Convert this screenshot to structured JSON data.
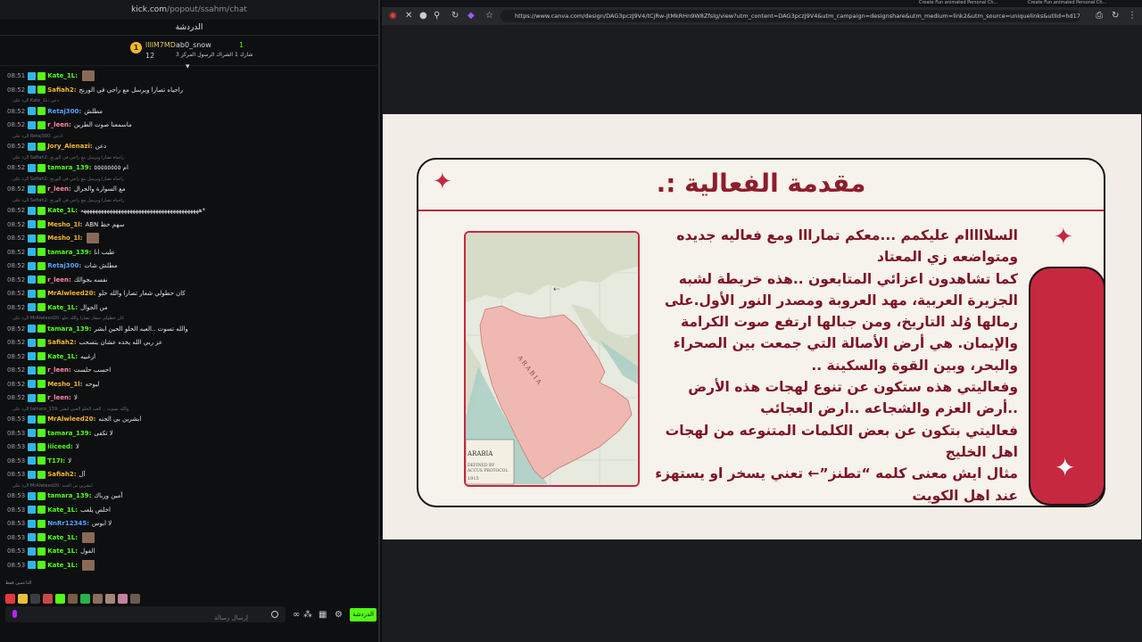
{
  "chat": {
    "url_domain": "kick.com",
    "url_path": "/popout/ssahm/chat",
    "title": "الدردشة",
    "pinned": {
      "gift_count_badge": "1",
      "user1": "llllM7MD",
      "user1_count": "12",
      "user2": "ab0_snow",
      "user2_text": "شارك 1 الشراك الرسول المركز 3",
      "user3_count": "1"
    },
    "messages": [
      {
        "type": "msg",
        "time": "08:51",
        "user": "Kate_1L:",
        "color": "#53fc18",
        "text": "",
        "pic": true
      },
      {
        "type": "msg",
        "time": "08:52",
        "user": "Safiah2:",
        "color": "#f2b632",
        "text": "راجياه تصارا ويرسل مع راجي في الورنج"
      },
      {
        "type": "reply",
        "text": "الرد على Kate_1L: دعن"
      },
      {
        "type": "msg",
        "time": "08:52",
        "user": "Retaj300:",
        "color": "#5aa2ff",
        "text": "مطلش"
      },
      {
        "type": "msg",
        "time": "08:52",
        "user": "r_leen:",
        "color": "#ff8aa8",
        "text": "ماسمعنا صوت الطرين"
      },
      {
        "type": "reply",
        "text": "الرد على Retaj300: ادعن"
      },
      {
        "type": "msg",
        "time": "08:52",
        "user": "Jory_Alenazi:",
        "color": "#f2b632",
        "text": "دعن"
      },
      {
        "type": "reply",
        "text": "الرد على Safiah2: راجياه تصارا ويرسل مع راجي في الورنج"
      },
      {
        "type": "msg",
        "time": "08:52",
        "user": "tamara_139:",
        "color": "#53fc18",
        "text": "ام ٥٥٥٥٥٥٥٥"
      },
      {
        "type": "reply",
        "text": "الرد على Safiah2: راجياه تصارا ويرسل مع راجي في الورنج"
      },
      {
        "type": "msg",
        "time": "08:52",
        "user": "r_leen:",
        "color": "#ff8aa8",
        "text": "مع السوارة والجرال"
      },
      {
        "type": "reply",
        "text": "الرد على Safiah2: راجياه تصارا ويرسل مع راجي في الورنج"
      },
      {
        "type": "msg",
        "time": "08:52",
        "user": "Kate_1L:",
        "color": "#53fc18",
        "text": "هههههههههههههههههههههههههههههههههههههههههه*"
      },
      {
        "type": "msg",
        "time": "08:52",
        "user": "Mesho_1l:",
        "color": "#f2b632",
        "text": "ABN سهم حظ"
      },
      {
        "type": "msg",
        "time": "08:52",
        "user": "Mesho_1l:",
        "color": "#f2b632",
        "text": "",
        "pic": true
      },
      {
        "type": "msg",
        "time": "08:52",
        "user": "tamara_139:",
        "color": "#53fc18",
        "text": "طيب انا"
      },
      {
        "type": "msg",
        "time": "08:52",
        "user": "Retaj300:",
        "color": "#5aa2ff",
        "text": "مطلش شات"
      },
      {
        "type": "msg",
        "time": "08:52",
        "user": "r_leen:",
        "color": "#ff8aa8",
        "text": "نفسه بجوالك"
      },
      {
        "type": "msg",
        "time": "08:52",
        "user": "MrAlwleed20:",
        "color": "#f2b632",
        "text": "كان حطولي شعار تصارا والله حلو"
      },
      {
        "type": "msg",
        "time": "08:52",
        "user": "Kate_1L:",
        "color": "#53fc18",
        "text": "من الجوال"
      },
      {
        "type": "reply",
        "text": "الرد على MrAlwleed20: كان حطولي شعار تصارا والله حلو"
      },
      {
        "type": "msg",
        "time": "08:52",
        "user": "tamara_139:",
        "color": "#53fc18",
        "text": "والله تسوت ..العبه الحلو الحين ابشر"
      },
      {
        "type": "msg",
        "time": "08:52",
        "user": "Safiah2:",
        "color": "#f2b632",
        "text": "عز ربي الله يخده عشان يتسحب"
      },
      {
        "type": "msg",
        "time": "08:52",
        "user": "Kate_1L:",
        "color": "#53fc18",
        "text": "ارغبيه"
      },
      {
        "type": "msg",
        "time": "08:52",
        "user": "r_leen:",
        "color": "#ff8aa8",
        "text": "احسب حلست"
      },
      {
        "type": "msg",
        "time": "08:52",
        "user": "Mesho_1l:",
        "color": "#f2b632",
        "text": "ليوحه"
      },
      {
        "type": "msg",
        "time": "08:52",
        "user": "r_leen:",
        "color": "#ff8aa8",
        "text": "لا"
      },
      {
        "type": "reply",
        "text": "الرد على tamara_139: والله تسوت .. العبه الحلو الحين ابشر"
      },
      {
        "type": "msg",
        "time": "08:53",
        "user": "MrAlwleed20:",
        "color": "#f2b632",
        "text": "ابشرين بي الجنه"
      },
      {
        "type": "msg",
        "time": "08:53",
        "user": "tamara_139:",
        "color": "#53fc18",
        "text": "لا تكفى"
      },
      {
        "type": "msg",
        "time": "08:53",
        "user": "iiiceed:",
        "color": "#53fc18",
        "text": "لا"
      },
      {
        "type": "msg",
        "time": "08:53",
        "user": "T17I:",
        "color": "#53fc18",
        "text": "لا"
      },
      {
        "type": "msg",
        "time": "08:53",
        "user": "Safiah2:",
        "color": "#f2b632",
        "text": "آل"
      },
      {
        "type": "reply",
        "text": "الرد على MrAlwleed20: ابشرين بي الجنه"
      },
      {
        "type": "msg",
        "time": "08:53",
        "user": "tamara_139:",
        "color": "#53fc18",
        "text": "آمين ورباك"
      },
      {
        "type": "msg",
        "time": "08:53",
        "user": "Kate_1L:",
        "color": "#53fc18",
        "text": "اخلص يلعب"
      },
      {
        "type": "msg",
        "time": "08:53",
        "user": "NnRr12345:",
        "color": "#5aa2ff",
        "text": "لا ابوس"
      },
      {
        "type": "msg",
        "time": "08:53",
        "user": "Kate_1L:",
        "color": "#53fc18",
        "text": "",
        "pic": true
      },
      {
        "type": "msg",
        "time": "08:53",
        "user": "Kate_1L:",
        "color": "#53fc18",
        "text": "الفول"
      },
      {
        "type": "msg",
        "time": "08:53",
        "user": "Kate_1L:",
        "color": "#53fc18",
        "text": "",
        "pic": true
      }
    ],
    "rules_text": "الداعمين فقط",
    "input_placeholder": "إرسال رسالة",
    "send_label": "الدردشة"
  },
  "browser": {
    "tab1": "Create Fun animated Personal Ch...",
    "tab2": "Create Fun animated Personal Ch...",
    "url": "https://www.canva.com/design/DAG3pczJ9V4/tCjRw-JtMkRHn9W8Zfslg/view?utm_content=DAG3pczJ9V4&utm_campaign=designshare&utm_medium=link2&utm_source=uniquelinks&utlId=hd17ea57504#2"
  },
  "slide": {
    "title": "مقدمة الفعالية :.",
    "paragraphs": [
      "السلااااام عليكمم ...معكم تمارااا ومع فعاليه جديده ومتواضعه زي المعتاد",
      "كما تشاهدون اعزائي المتابعون ..هذه خريطة لشبه الجزيرة العربية، مهد العروبة ومصدر النور الأول.على رمالها وُلد التاريخ، ومن جبالها ارتفع صوت الكرامة والإيمان. هي أرض الأصالة التي جمعت بين الصحراء والبحر، وبين القوة والسكينة ..",
      "وفعاليتي هذه ستكون عن تنوع لهجات هذه الأرض ..أرض العزم والشجاعه ..ارض العجائب",
      "فعاليتي بتكون عن بعض الكلمات المتنوعه من لهجات اهل الخليج",
      "مثال ايش معنى كلمه “تطنز”← تعني يسخر او يستهزء عند اهل الكويت"
    ],
    "map": {
      "region_label": "ARABIA",
      "legend_line1": "ARABIA",
      "legend_line2": "DEFINED BY",
      "legend_line3": "ACCUS PROTOCOL",
      "legend_year": "1915"
    },
    "colors": {
      "accent": "#c4283f",
      "text": "#7c1424",
      "background": "#f2eee7"
    }
  }
}
